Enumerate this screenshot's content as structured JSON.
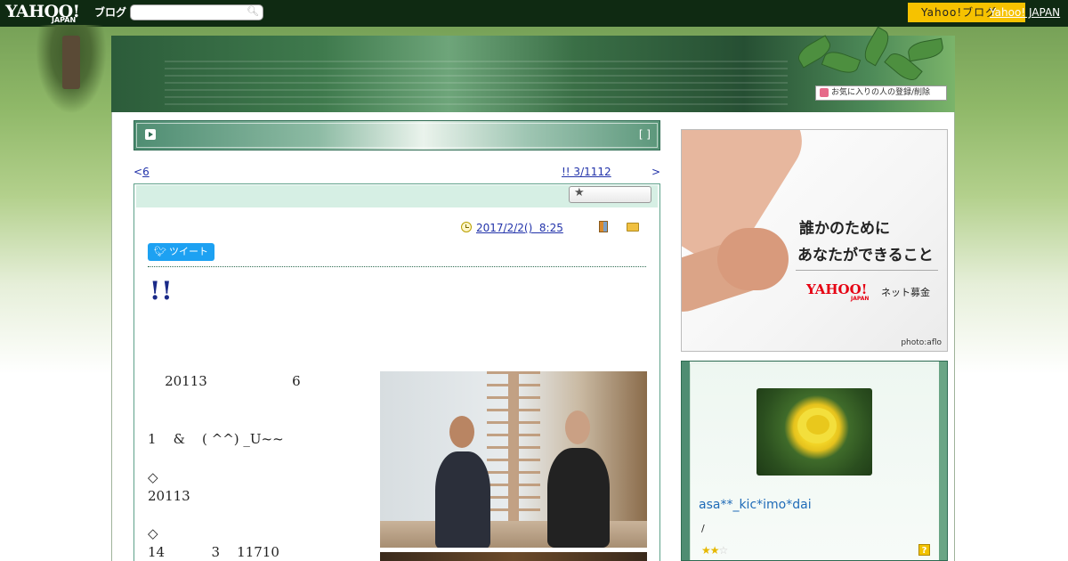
{
  "topbar": {
    "logo_text": "YAHOO!",
    "logo_sub": "JAPAN",
    "service": "ブログ",
    "search_placeholder": "",
    "yahoo_button": "Yahoo!ブログ",
    "yahoo_japan_link": "Yahoo! JAPAN"
  },
  "header": {
    "favorites_label": "お気に入りの人の登録/削除"
  },
  "post_title_bar": {
    "brackets": "[ ]"
  },
  "nav": {
    "prev_arrow": "<",
    "prev_label": "6",
    "next_label": "!! 3/1112",
    "next_arrow": ">"
  },
  "article": {
    "date": "2017/2/2()  8:25",
    "tweet_label": "ツイート",
    "headline": "!!",
    "body": {
      "line1": "    20113                    6",
      "line2": "1    &    ( ^^) _U~~",
      "line3": "◇",
      "line4": "20113",
      "line5": "◇",
      "line6": "14           3    11710"
    }
  },
  "ad": {
    "line1": "誰かのために",
    "line2": "あなたができること",
    "logo": "YAHOO!",
    "logo_sub": "JAPAN",
    "service": "ネット募金",
    "credit": "photo:aflo"
  },
  "profile": {
    "username": "asa**_kic*imo*dai",
    "slash": "/",
    "rating": 2,
    "rating_max": 3,
    "help": "?"
  },
  "colors": {
    "topbar_bg": "#0f2a12",
    "accent_green": "#2e6b52",
    "link_blue": "#2233aa",
    "yahoo_yellow": "#f6c200"
  },
  "icons": {
    "search": "search-icon",
    "clock": "clock-icon",
    "book": "book-icon",
    "folder": "folder-icon",
    "star": "star-icon",
    "twitter": "twitter-bird-icon",
    "help": "help-icon"
  }
}
